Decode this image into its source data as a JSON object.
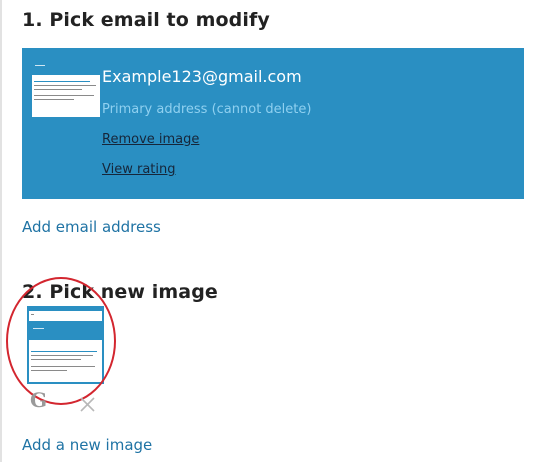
{
  "step1": {
    "heading": "1. Pick email to modify",
    "card": {
      "email": "Example123@gmail.com",
      "note": "Primary address (cannot delete)",
      "remove_image": "Remove image",
      "view_rating": "View rating"
    },
    "add_email": "Add email address"
  },
  "step2": {
    "heading": "2. Pick new image",
    "image_icons": [
      "google-icon",
      "close-icon"
    ],
    "add_image": "Add a new image"
  },
  "colors": {
    "card_background": "#2a8fc2",
    "link": "#1f73a4",
    "heading": "#222222",
    "highlight_circle": "#d3262f",
    "note_text": "#8fd0f0"
  }
}
